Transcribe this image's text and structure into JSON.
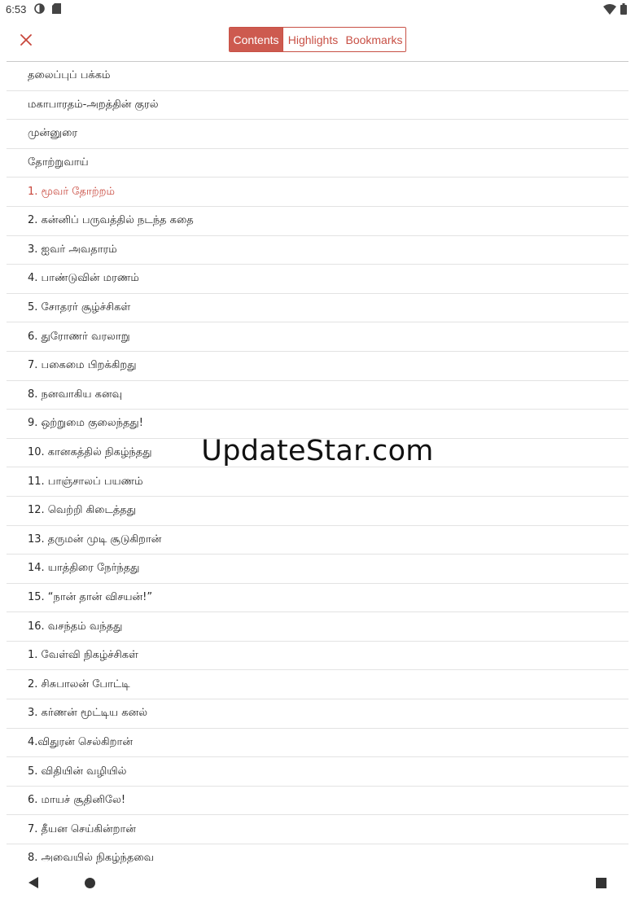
{
  "status_bar": {
    "time": "6:53",
    "left_icons": [
      "sync-icon",
      "sd-card-icon"
    ],
    "right_icons": [
      "wifi-icon",
      "battery-icon"
    ]
  },
  "toolbar": {
    "close_icon": "close-icon",
    "tabs": [
      {
        "label": "Contents",
        "active": true
      },
      {
        "label": "Highlights",
        "active": false
      },
      {
        "label": "Bookmarks",
        "active": false
      }
    ]
  },
  "colors": {
    "accent": "#cd5a4f",
    "accent_text": "#c8473c",
    "divider": "#e3e3e3"
  },
  "toc": {
    "current_index": 4,
    "items": [
      "தலைப்புப் பக்கம்",
      "மகாபாரதம்-அறத்தின் குரல்",
      "முன்னுரை",
      "தோற்றுவாய்",
      "1. மூவர் தோற்றம்",
      "2. கன்னிப் பருவத்தில் நடந்த கதை",
      "3. ஐவர் அவதாரம்",
      "4. பாண்டுவின் மரணம்",
      "5. சோதரர் சூழ்ச்சிகள்",
      "6. துரோணர் வரலாறு",
      "7. பகைமை பிறக்கிறது",
      "8. நனவாகிய கனவு",
      "9. ஒற்றுமை குலைந்தது!",
      "10. கானகத்தில் நிகழ்ந்தது",
      "11. பாஞ்சாலப் பயணம்",
      "12. வெற்றி கிடைத்தது",
      "13. தருமன் முடி சூடுகிறான்",
      "14. யாத்திரை நேர்ந்தது",
      "15. “நான் தான் விசயன்!”",
      "16. வசந்தம் வந்தது",
      "1. வேள்வி நிகழ்ச்சிகள்",
      "2. சிசுபாலன் போட்டி",
      "3. கர்ணன் மூட்டிய கனல்",
      "4.விதுரன் செல்கிறான்",
      "5. விதியின் வழியில்",
      "6. மாயச் சூதினிலே!",
      "7. தீயன செய்கின்றான்",
      "8. அவையில் நிகழ்ந்தவை"
    ]
  },
  "watermark": "UpdateStar.com",
  "nav_bar": {
    "icons": [
      "back-icon",
      "home-icon",
      "recents-icon"
    ]
  }
}
